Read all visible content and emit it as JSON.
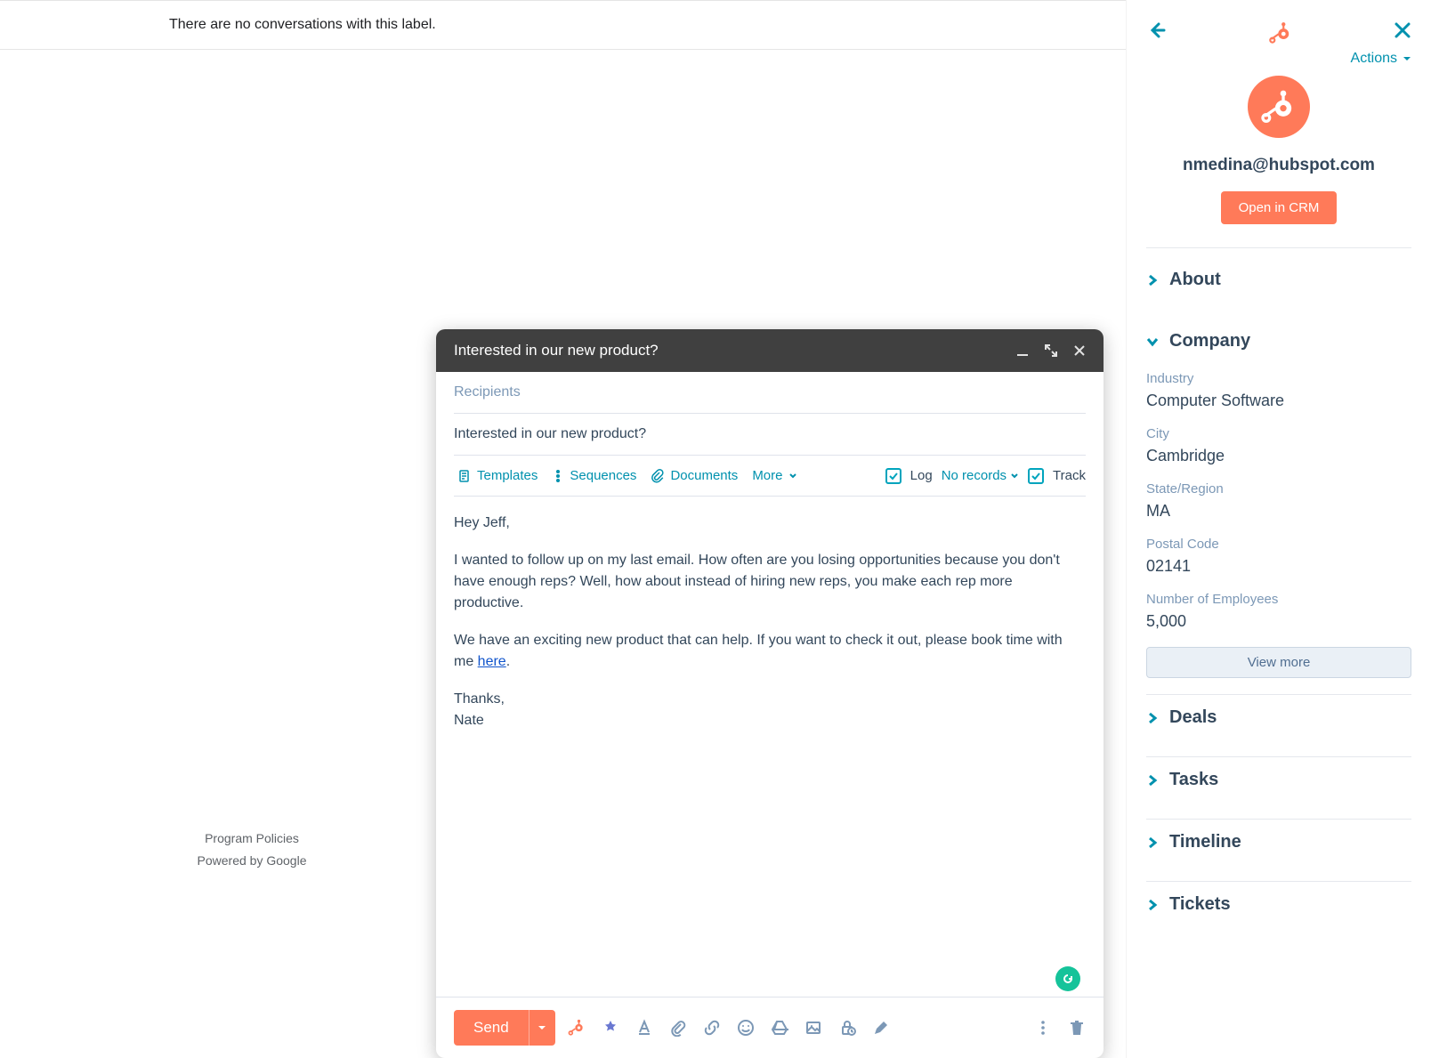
{
  "inbox": {
    "empty_message": "There are no conversations with this label."
  },
  "footer": {
    "policies": "Program Policies",
    "powered": "Powered by Google"
  },
  "compose": {
    "title": "Interested in our new product?",
    "recipients_placeholder": "Recipients",
    "subject": "Interested in our new product?",
    "tools": {
      "templates": "Templates",
      "sequences": "Sequences",
      "documents": "Documents",
      "more": "More"
    },
    "log": {
      "label": "Log",
      "records": "No records"
    },
    "track_label": "Track",
    "body": {
      "greeting": "Hey Jeff,",
      "p1": "I wanted to follow up on my last email. How often are you losing opportunities because you don't have enough reps? Well, how about instead of hiring new reps, you make each rep more productive.",
      "p2a": "We have an exciting new product that can help. If you want to check it out, please book time with me ",
      "p2_link": "here",
      "p2b": ".",
      "thanks": "Thanks,",
      "signature": "Nate"
    },
    "send_label": "Send"
  },
  "sidebar": {
    "actions_label": "Actions",
    "contact_email": "nmedina@hubspot.com",
    "open_crm": "Open in CRM",
    "sections": {
      "about": "About",
      "company": "Company",
      "deals": "Deals",
      "tasks": "Tasks",
      "timeline": "Timeline",
      "tickets": "Tickets"
    },
    "company": {
      "industry_label": "Industry",
      "industry_value": "Computer Software",
      "city_label": "City",
      "city_value": "Cambridge",
      "state_label": "State/Region",
      "state_value": "MA",
      "postal_label": "Postal Code",
      "postal_value": "02141",
      "employees_label": "Number of Employees",
      "employees_value": "5,000",
      "view_more": "View more"
    }
  }
}
